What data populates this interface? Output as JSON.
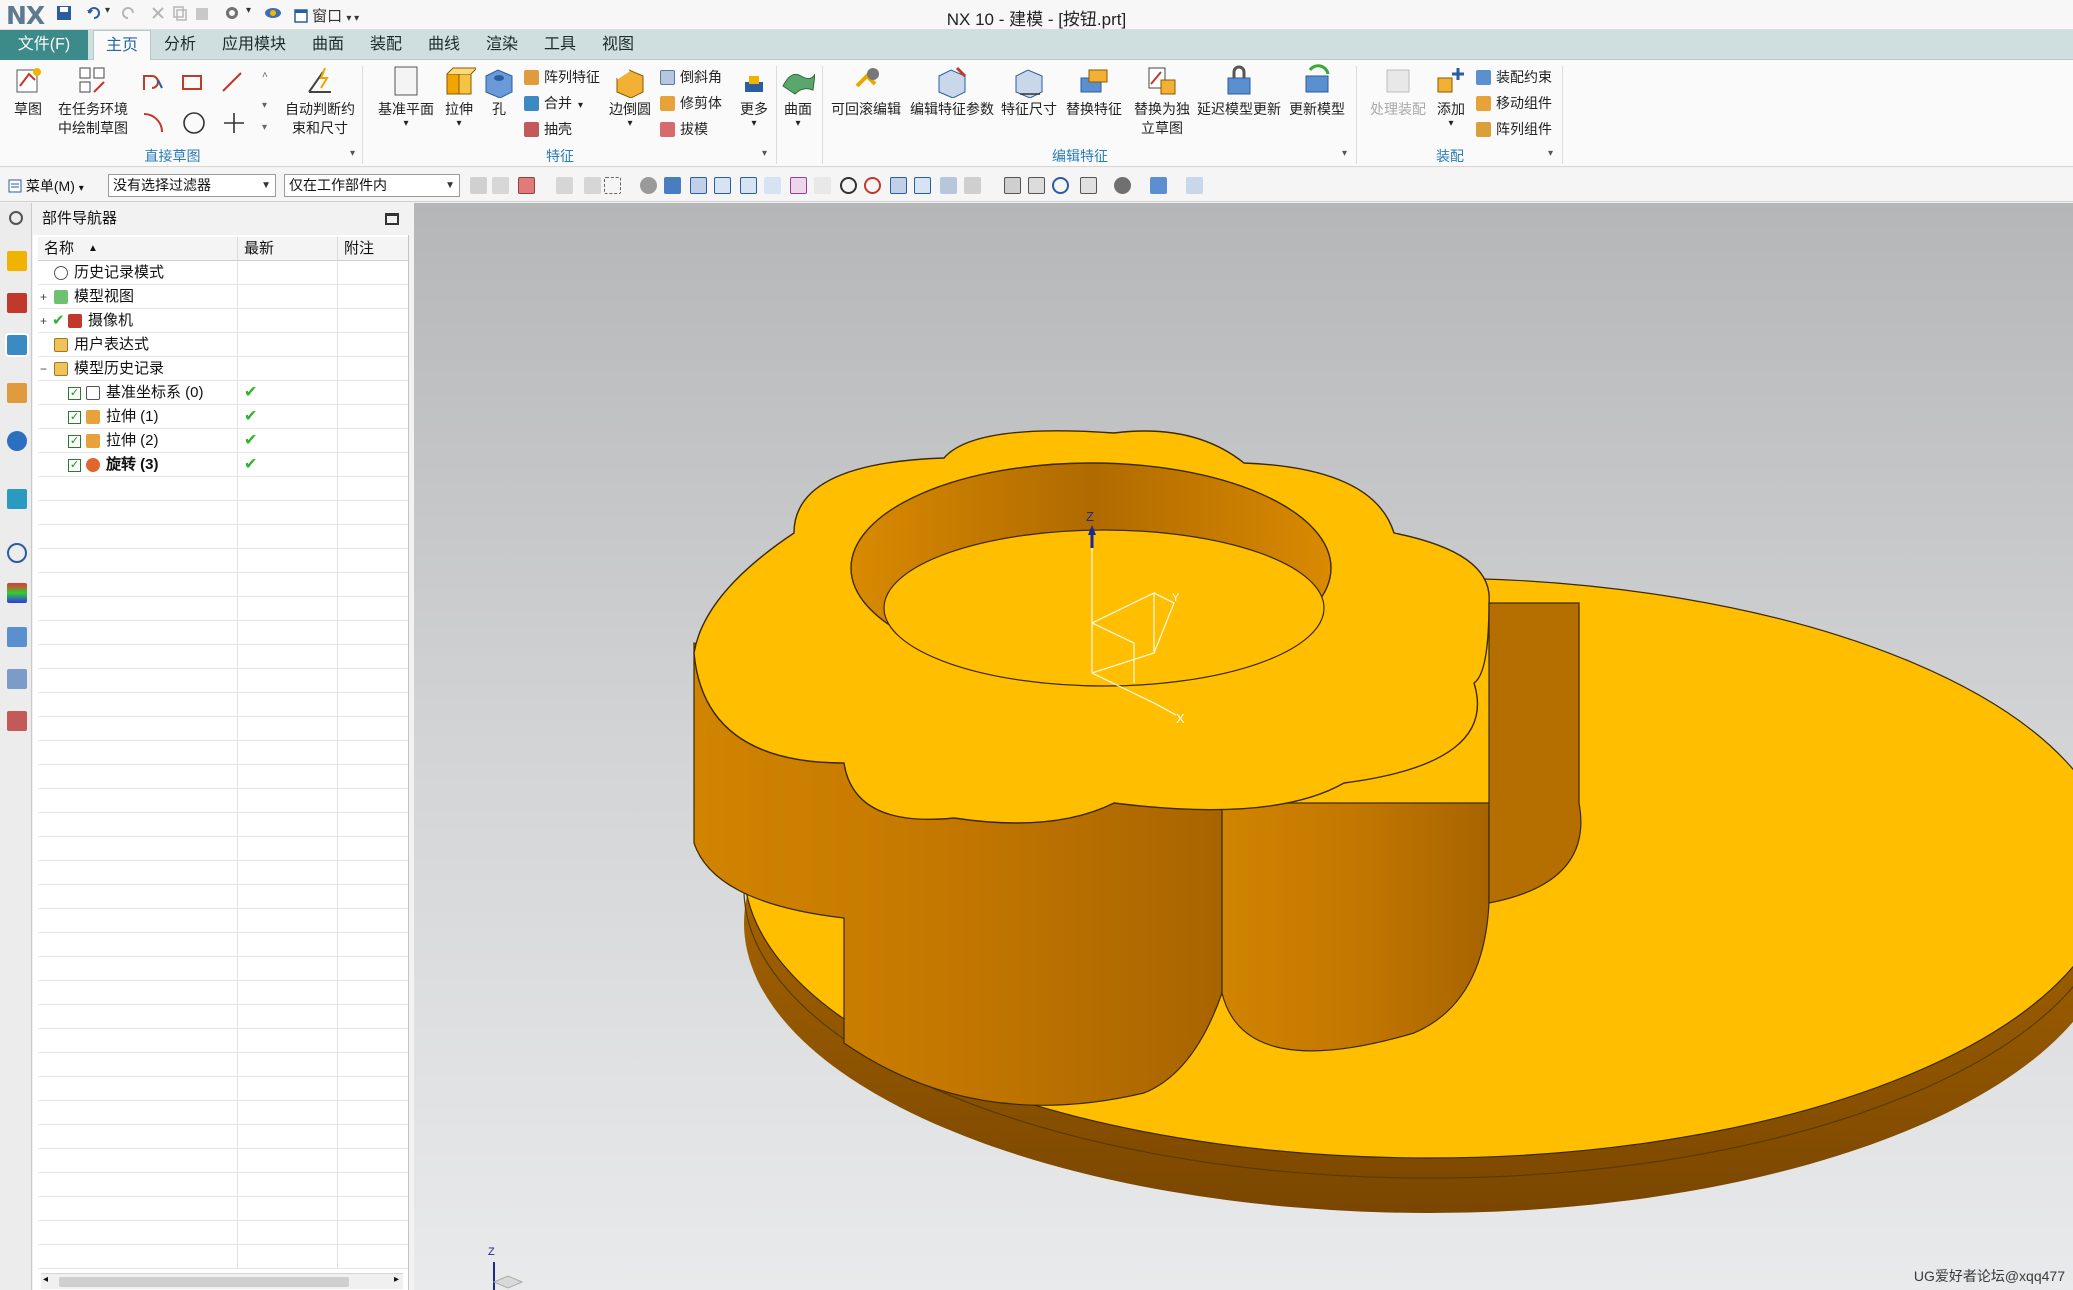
{
  "titlebar": {
    "logo_main": "NX",
    "title": "NX 10 - 建模 - [按钮.prt]",
    "window_menu": "窗口"
  },
  "menubar": {
    "file": "文件(F)",
    "tabs": [
      "主页",
      "分析",
      "应用模块",
      "曲面",
      "装配",
      "曲线",
      "渲染",
      "工具",
      "视图"
    ]
  },
  "ribbon": {
    "sketch": {
      "label": "草图"
    },
    "task_sketch": {
      "line1": "在任务环境",
      "line2": "中绘制草图"
    },
    "auto_constraint": {
      "line1": "自动判断约",
      "line2": "束和尺寸"
    },
    "group_direct_sketch": "直接草图",
    "datum_plane": "基准平面",
    "extrude": "拉伸",
    "hole": "孔",
    "pattern_feature": "阵列特征",
    "unite": "合并",
    "shell": "抽壳",
    "edge_blend": "边倒圆",
    "chamfer": "倒斜角",
    "trim_body": "修剪体",
    "draft": "拔模",
    "more": "更多",
    "surface": "曲面",
    "group_feature": "特征",
    "rollback_edit": "可回滚编辑",
    "edit_feature_params": "编辑特征参数",
    "feature_dimensions": "特征尺寸",
    "replace_feature": "替换特征",
    "replace_sketch": {
      "line1": "替换为独",
      "line2": "立草图"
    },
    "delay_update": "延迟模型更新",
    "update_model": "更新模型",
    "group_edit_feature": "编辑特征",
    "process_assembly": "处理装配",
    "add": "添加",
    "assembly_constraint": "装配约束",
    "move_component": "移动组件",
    "pattern_component": "阵列组件",
    "group_assembly": "装配"
  },
  "toolbar": {
    "menu": "菜单(M)",
    "filter": "没有选择过滤器",
    "scope": "仅在工作部件内"
  },
  "navigator": {
    "title": "部件导航器",
    "col_name": "名称",
    "col_latest": "最新",
    "col_note": "附注",
    "rows": [
      {
        "label": "历史记录模式"
      },
      {
        "label": "模型视图"
      },
      {
        "label": "摄像机"
      },
      {
        "label": "用户表达式"
      },
      {
        "label": "模型历史记录"
      },
      {
        "label": "基准坐标系 (0)"
      },
      {
        "label": "拉伸 (1)"
      },
      {
        "label": "拉伸 (2)"
      },
      {
        "label": "旋转 (3)"
      }
    ]
  },
  "viewport": {
    "axis_z": "Z",
    "axis_x": "X",
    "axis_y": "Y",
    "triad_z": "Z",
    "watermark": "UG爱好者论坛@xqq477"
  },
  "colors": {
    "accent_teal": "#3c8a8a",
    "part_top": "#FFBF00",
    "part_side": "#C77A00",
    "check_green": "#2db52d"
  }
}
